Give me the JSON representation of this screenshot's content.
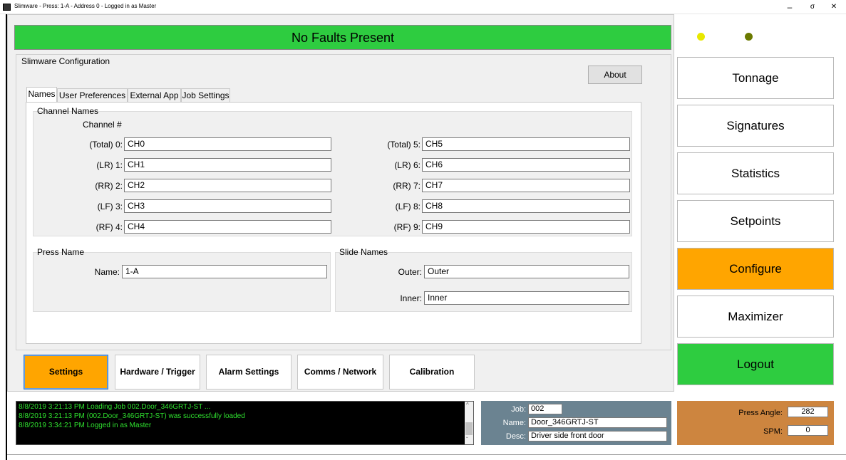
{
  "window": {
    "title": "Slimware - Press: 1-A - Address 0 - Logged in as Master",
    "minimize": "–",
    "maximize": "σ",
    "close": "✕"
  },
  "status": {
    "fault_text": "No Faults Present",
    "led1_color": "#e8e800",
    "led2_color": "#6b7a00"
  },
  "config": {
    "title": "Slimware Configuration",
    "about_label": "About",
    "tabs": [
      {
        "label": "Names"
      },
      {
        "label": "User Preferences"
      },
      {
        "label": "External App"
      },
      {
        "label": "Job Settings"
      }
    ],
    "channel_names": {
      "title": "Channel Names",
      "header": "Channel #",
      "left": [
        {
          "label": "(Total) 0:",
          "value": "CH0"
        },
        {
          "label": "(LR) 1:",
          "value": "CH1"
        },
        {
          "label": "(RR) 2:",
          "value": "CH2"
        },
        {
          "label": "(LF) 3:",
          "value": "CH3"
        },
        {
          "label": "(RF) 4:",
          "value": "CH4"
        }
      ],
      "right": [
        {
          "label": "(Total) 5:",
          "value": "CH5"
        },
        {
          "label": "(LR) 6:",
          "value": "CH6"
        },
        {
          "label": "(RR) 7:",
          "value": "CH7"
        },
        {
          "label": "(LF) 8:",
          "value": "CH8"
        },
        {
          "label": "(RF) 9:",
          "value": "CH9"
        }
      ]
    },
    "press_name": {
      "title": "Press Name",
      "label": "Name:",
      "value": "1-A"
    },
    "slide_names": {
      "title": "Slide Names",
      "outer_label": "Outer:",
      "outer_value": "Outer",
      "inner_label": "Inner:",
      "inner_value": "Inner"
    }
  },
  "bottom_buttons": {
    "settings": "Settings",
    "hardware": "Hardware / Trigger",
    "alarm": "Alarm Settings",
    "comms": "Comms / Network",
    "calibration": "Calibration"
  },
  "nav": {
    "tonnage": "Tonnage",
    "signatures": "Signatures",
    "statistics": "Statistics",
    "setpoints": "Setpoints",
    "configure": "Configure",
    "maximizer": "Maximizer",
    "logout": "Logout"
  },
  "log": [
    "8/8/2019 3:21:13 PM  Loading Job 002.Door_346GRTJ-ST ...",
    "8/8/2019 3:21:13 PM  (002.Door_346GRTJ-ST) was successfully loaded",
    "8/8/2019 3:34:21 PM  Logged in as Master"
  ],
  "job": {
    "job_label": "Job:",
    "job_value": "002",
    "name_label": "Name:",
    "name_value": "Door_346GRTJ-ST",
    "desc_label": "Desc:",
    "desc_value": "Driver side front door"
  },
  "press": {
    "angle_label": "Press Angle:",
    "angle_value": "282",
    "spm_label": "SPM:",
    "spm_value": "0"
  }
}
